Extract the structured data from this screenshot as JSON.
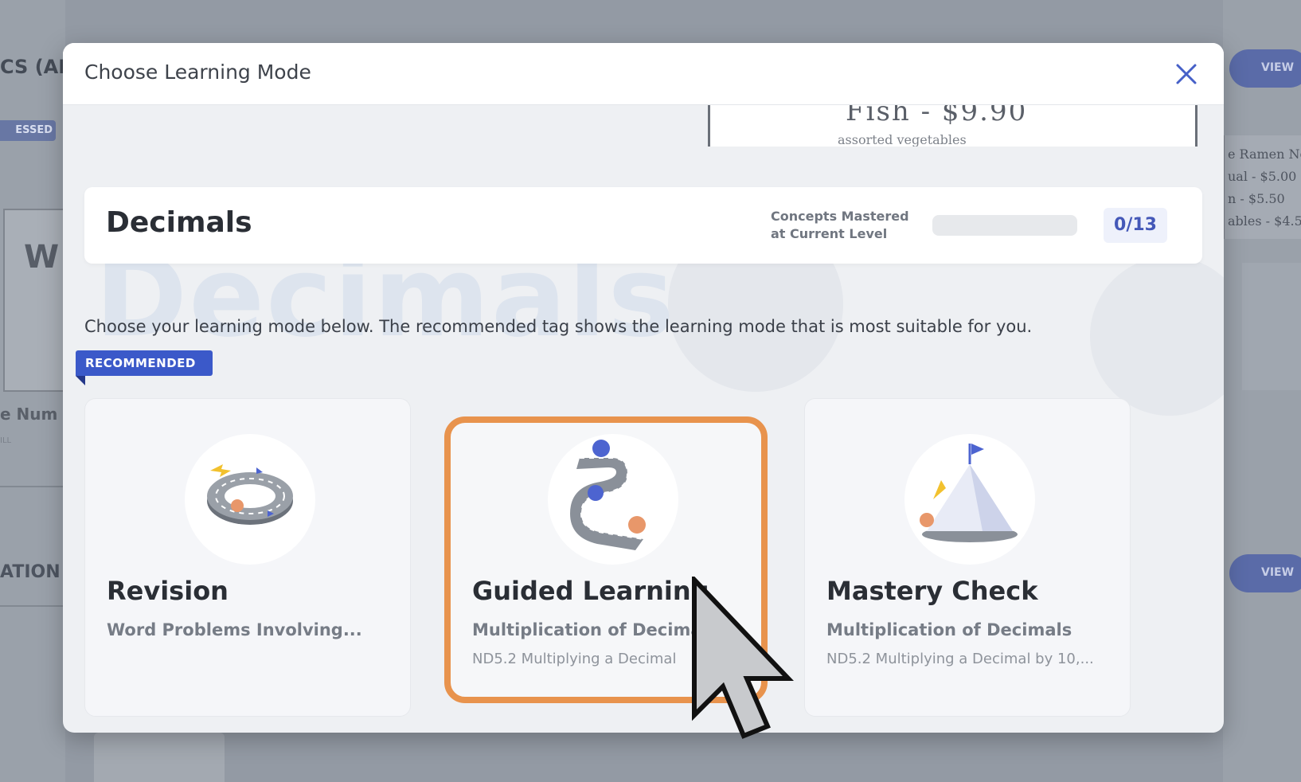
{
  "background": {
    "left_title": "CS (AL",
    "left_badge": "ESSED",
    "left_card_letter": "W",
    "left_num": "e Num",
    "left_tiny": "ILL",
    "left_section": "ATION",
    "right_button": "VIEW",
    "right_note": [
      "e Ramen No",
      "ual - $5.00",
      "n - $5.50",
      "ables - $4.5"
    ]
  },
  "modal": {
    "title": "Choose Learning Mode",
    "close_icon": "close-icon",
    "sheet_peek_line1": "Fish - $9.90",
    "sheet_peek_line2": "assorted vegetables",
    "watermark": "Decimals",
    "topic": {
      "title": "Decimals",
      "mastered_label": "Concepts Mastered at Current Level",
      "mastered_count": "0/13",
      "mastered_fraction": 0
    },
    "instructions": "Choose your learning mode below. The recommended tag shows the learning mode that is most suitable for you.",
    "recommended_tag": "RECOMMENDED",
    "modes": [
      {
        "title": "Revision",
        "subtitle": "Word Problems Involving...",
        "detail": "",
        "icon": "ring-road-icon",
        "recommended": true
      },
      {
        "title": "Guided Learning",
        "subtitle": "Multiplication of Decima",
        "detail": "ND5.2 Multiplying a Decimal",
        "icon": "winding-road-icon",
        "highlighted": true
      },
      {
        "title": "Mastery Check",
        "subtitle": "Multiplication of Decimals",
        "detail": "ND5.2 Multiplying a Decimal by 10,...",
        "icon": "mountain-flag-icon"
      }
    ]
  },
  "colors": {
    "accent_blue": "#3b59c9",
    "highlight_orange": "#e8934d",
    "progress_text": "#4458b8"
  }
}
